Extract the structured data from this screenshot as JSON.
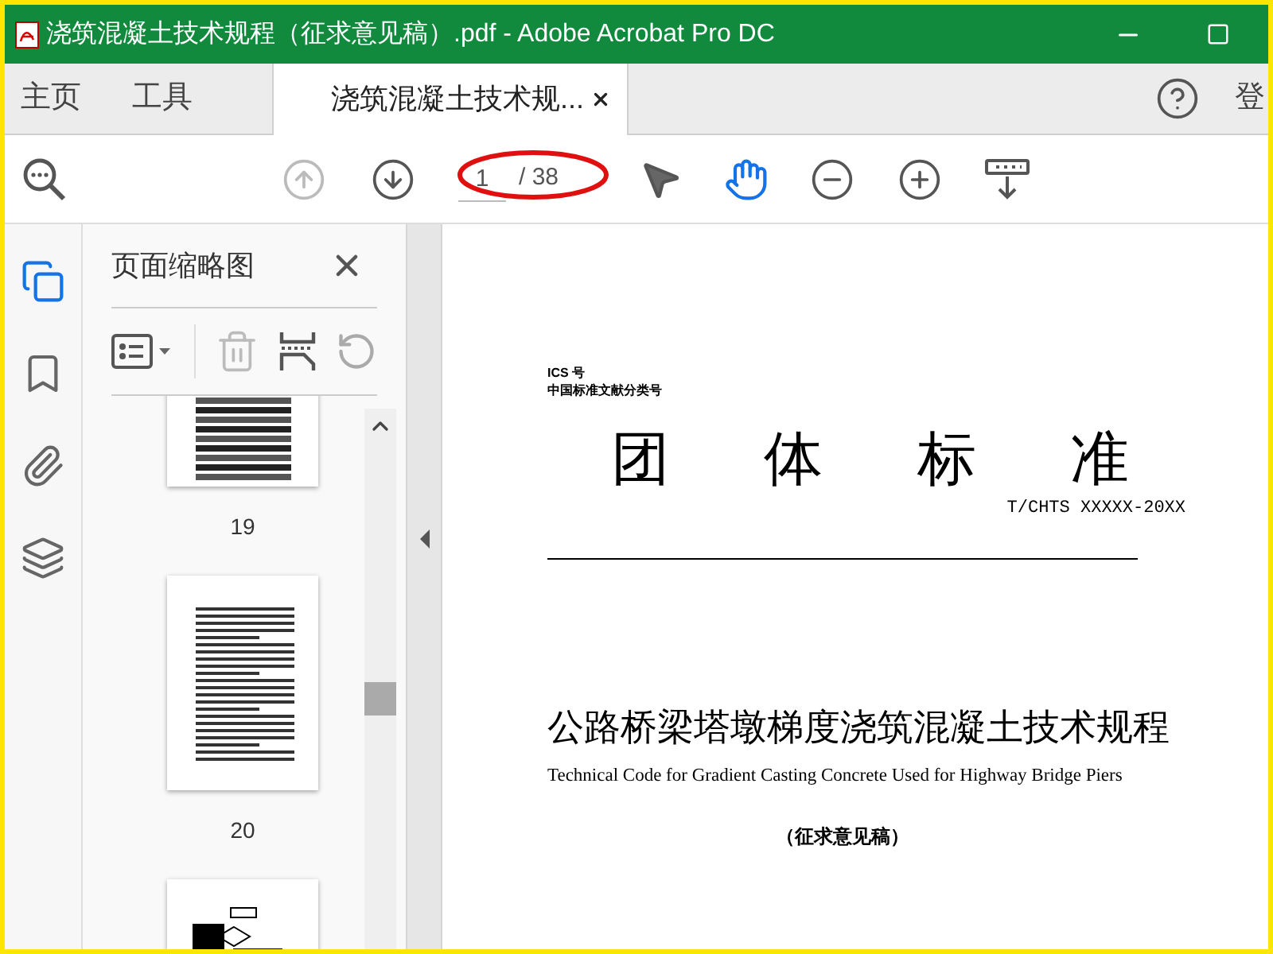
{
  "window": {
    "title": "浇筑混凝土技术规程（征求意见稿）.pdf - Adobe Acrobat Pro DC"
  },
  "tabs": [
    {
      "label": "主页",
      "selected": false
    },
    {
      "label": "工具",
      "selected": false
    },
    {
      "label": "浇筑混凝土技术规...",
      "selected": true
    }
  ],
  "account_label": "登",
  "toolbar": {
    "prev_page_disabled": true,
    "page_number": "1",
    "page_total": "/ 38",
    "tools": [
      {
        "kind": "select",
        "selected": false
      },
      {
        "kind": "hand",
        "selected": true
      }
    ]
  },
  "side_rail": [
    {
      "kind": "pages",
      "selected": true
    },
    {
      "kind": "bookmarks",
      "selected": false
    },
    {
      "kind": "attachments",
      "selected": false
    },
    {
      "kind": "layers",
      "selected": false
    }
  ],
  "thumbnail_panel": {
    "title": "页面缩略图",
    "delete_disabled": true,
    "thumbnails": [
      {
        "kind": "table",
        "label": "19"
      },
      {
        "kind": "text",
        "label": "20"
      },
      {
        "kind": "diagram"
      }
    ]
  },
  "document": {
    "ics": "ICS 号",
    "classification": "中国标准文献分类号",
    "heading": "团体标准",
    "code": "T/CHTS XXXXX-20XX",
    "title_zh": "公路桥梁塔墩梯度浇筑混凝土技术规程",
    "title_en": "Technical Code for Gradient Casting Concrete Used for Highway Bridge Piers",
    "status": "（征求意见稿）"
  }
}
